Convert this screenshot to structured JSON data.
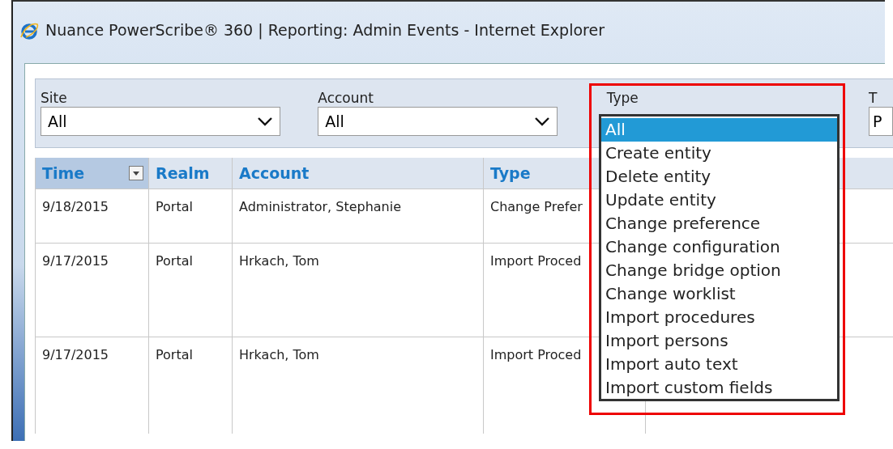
{
  "window": {
    "title": "Nuance PowerScribe® 360 | Reporting: Admin Events - Internet Explorer"
  },
  "filters": [
    {
      "label": "Site",
      "value": "All",
      "kind": "select"
    },
    {
      "label": "Account",
      "value": "All",
      "kind": "select"
    },
    {
      "label": "Type",
      "kind": "open"
    },
    {
      "label": "T",
      "value": "P",
      "kind": "cut"
    }
  ],
  "type_dropdown": {
    "options": [
      {
        "label": "All",
        "selected": true
      },
      {
        "label": "Create entity",
        "selected": false
      },
      {
        "label": "Delete entity",
        "selected": false
      },
      {
        "label": "Update entity",
        "selected": false
      },
      {
        "label": "Change preference",
        "selected": false
      },
      {
        "label": "Change configuration",
        "selected": false
      },
      {
        "label": "Change bridge option",
        "selected": false
      },
      {
        "label": "Change worklist",
        "selected": false
      },
      {
        "label": "Import procedures",
        "selected": false
      },
      {
        "label": "Import persons",
        "selected": false
      },
      {
        "label": "Import auto text",
        "selected": false
      },
      {
        "label": "Import custom fields",
        "selected": false
      }
    ]
  },
  "table": {
    "columns": [
      {
        "label": "Time",
        "sorted": true
      },
      {
        "label": "Realm",
        "sorted": false
      },
      {
        "label": "Account",
        "sorted": false
      },
      {
        "label": "Type",
        "sorted": false
      }
    ],
    "rows": [
      [
        "9/18/2015",
        "Portal",
        "Administrator, Stephanie",
        "Change Prefer"
      ],
      [
        "9/17/2015",
        "Portal",
        "Hrkach, Tom",
        "Import Proced"
      ],
      [
        "9/17/2015",
        "Portal",
        "Hrkach, Tom",
        "Import Proced"
      ]
    ]
  }
}
